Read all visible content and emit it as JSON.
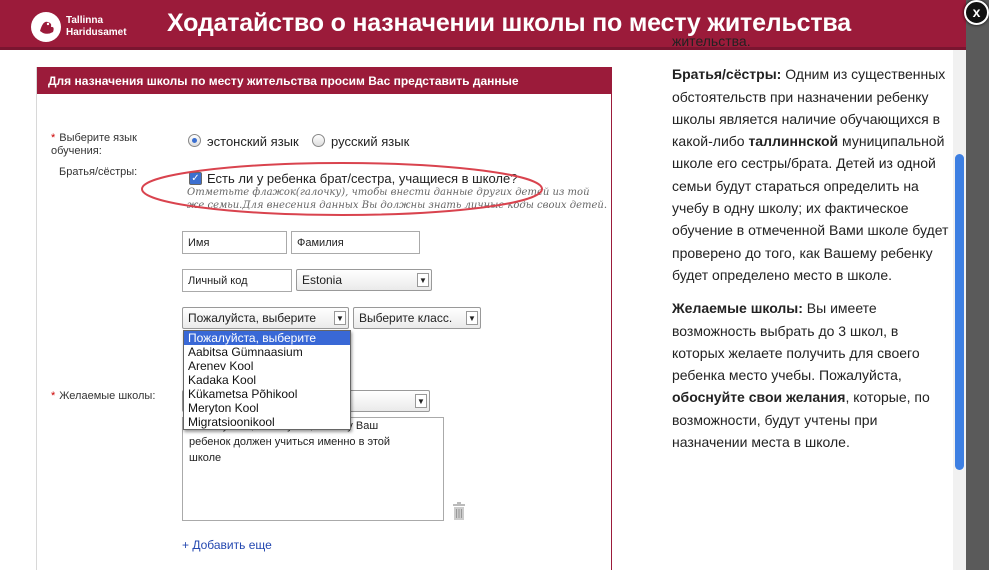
{
  "header": {
    "logo_line1": "Tallinna",
    "logo_line2": "Haridusamet",
    "title": "Ходатайство о назначении школы по месту жительства",
    "close": "x"
  },
  "form": {
    "section_header": "Для назначения школы по месту жительства просим Вас представить данные",
    "language_label": "Выберите язык обучения:",
    "language_options": [
      "эстонский язык",
      "русский язык"
    ],
    "language_selected": "эстонский язык",
    "siblings_label": "Братья/сёстры:",
    "siblings_checkbox_label": "Есть ли у ребенка брат/сестра, учащиеся в школе?",
    "siblings_checked": true,
    "siblings_hint": "Отметьте флажок(галочку), чтобы внести данные других детей из той же семьи.Для внесения данных Вы должны знать личные коды своих детей.",
    "first_name_placeholder": "Имя",
    "last_name_placeholder": "Фамилия",
    "id_code_placeholder": "Личный код",
    "country_value": "Estonia",
    "school_select_value": "Пожалуйста, выберите",
    "class_select_value": "Выберите класс.",
    "school_options": [
      "Пожалуйста, выберите",
      "Aabitsa Gümnaasium",
      "Arenev Kool",
      "Kadaka Kool",
      "Kükametsa Põhikool",
      "Meryton Kool",
      "Migratsioonikool"
    ],
    "desired_schools_label": "Желаемые школы:",
    "textarea_line1": "Пожалуйста, обоснуйте, почему Ваш",
    "textarea_line2": "ребенок должен учиться именно в этой",
    "textarea_line3": "школе",
    "add_more": "+ Добавить еще"
  },
  "help": {
    "top_fragment": "жительства.",
    "siblings_title": "Братья/сёстры:",
    "siblings_text_1": " Одним из существенных обстоятельств при назначении ребенку школы является наличие обучающихся в какой-либо ",
    "siblings_bold": "таллиннской",
    "siblings_text_2": " муниципальной школе его сестры/брата. Детей из одной семьи будут стараться определить на учебу в одну школу; их фактическое обучение в отмеченной Вами школе будет проверено до того, как Вашему ребенку будет определено место в школе.",
    "schools_title": "Желаемые школы:",
    "schools_text_1": " Вы имеете возможность выбрать до 3 школ, в которых желаете получить для своего ребенка место учебы. Пожалуйста, ",
    "schools_bold": "обоснуйте свои желания",
    "schools_text_2": ", которые, по возможности, будут учтены при назначении места в школе."
  },
  "colors": {
    "brand": "#9b1b3a",
    "selection": "#3968d6",
    "annotation": "#d9434e"
  }
}
